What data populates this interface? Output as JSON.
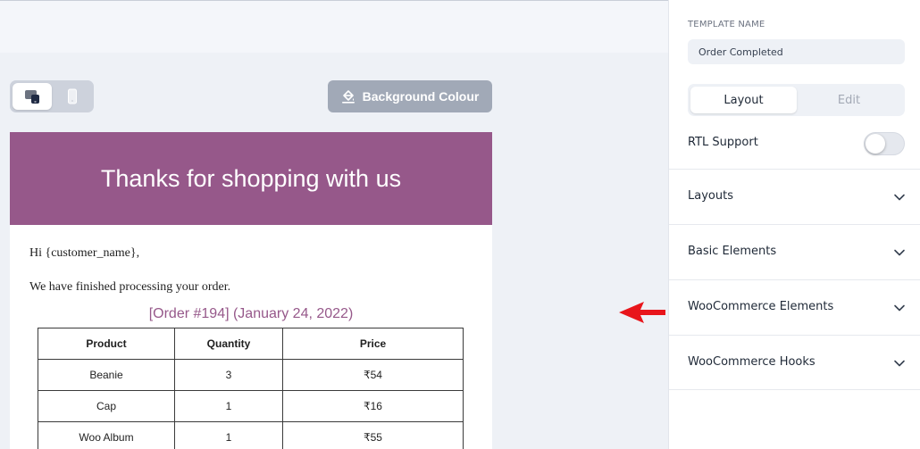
{
  "toolbar": {
    "background_colour_label": "Background Colour"
  },
  "email": {
    "header_title": "Thanks for shopping with us",
    "greeting": "Hi {customer_name},",
    "body_line": "We have finished processing your order.",
    "order_heading": "[Order #194] (January 24, 2022)",
    "table": {
      "headers": [
        "Product",
        "Quantity",
        "Price"
      ],
      "rows": [
        [
          "Beanie",
          "3",
          "₹54"
        ],
        [
          "Cap",
          "1",
          "₹16"
        ],
        [
          "Woo Album",
          "1",
          "₹55"
        ]
      ]
    },
    "colors": {
      "header_bg": "#96588a",
      "heading_text": "#96588a"
    }
  },
  "sidebar": {
    "template_name_label": "TEMPLATE NAME",
    "template_name_value": "Order Completed",
    "tabs": [
      {
        "label": "Layout",
        "active": true
      },
      {
        "label": "Edit",
        "active": false
      }
    ],
    "rtl_label": "RTL Support",
    "rtl_enabled": false,
    "sections": [
      {
        "label": "Layouts",
        "icon": "chevron-down-icon"
      },
      {
        "label": "Basic Elements",
        "icon": "chevron-down-icon"
      },
      {
        "label": "WooCommerce Elements",
        "icon": "chevron-down-icon"
      },
      {
        "label": "WooCommerce Hooks",
        "icon": "chevron-down-icon"
      }
    ]
  },
  "annotation": {
    "icon": "red-arrow-icon",
    "color": "#e8151b"
  }
}
